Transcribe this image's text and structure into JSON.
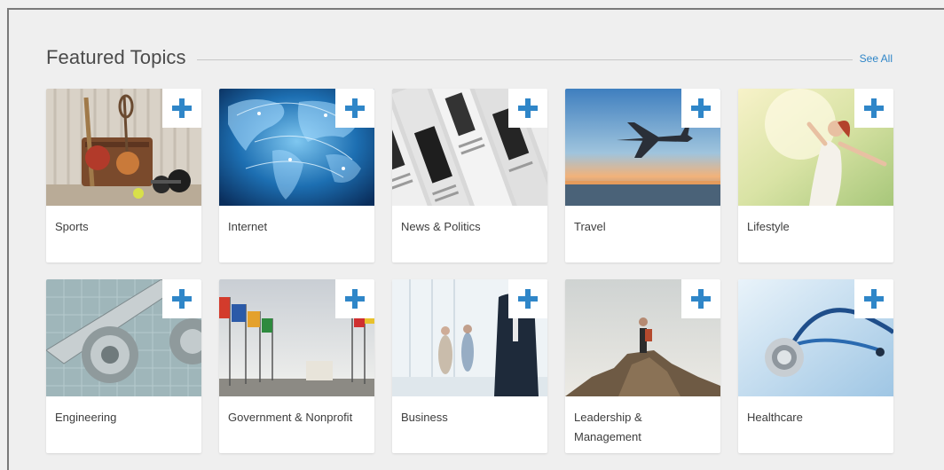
{
  "header": {
    "title": "Featured Topics",
    "see_all": "See All"
  },
  "topics": [
    {
      "label": "Sports",
      "icon": "plus-icon"
    },
    {
      "label": "Internet",
      "icon": "plus-icon"
    },
    {
      "label": "News & Politics",
      "icon": "plus-icon"
    },
    {
      "label": "Travel",
      "icon": "plus-icon"
    },
    {
      "label": "Lifestyle",
      "icon": "plus-icon"
    },
    {
      "label": "Engineering",
      "icon": "plus-icon"
    },
    {
      "label": "Government & Nonprofit",
      "icon": "plus-icon"
    },
    {
      "label": "Business",
      "icon": "plus-icon"
    },
    {
      "label": "Leadership & Management",
      "icon": "plus-icon"
    },
    {
      "label": "Healthcare",
      "icon": "plus-icon"
    }
  ],
  "colors": {
    "accent": "#2f86c8",
    "background": "#efefef",
    "card": "#ffffff"
  }
}
